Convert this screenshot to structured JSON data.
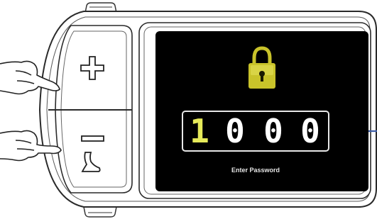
{
  "screen": {
    "password_digits": [
      "1",
      "0",
      "0",
      "0"
    ],
    "active_digit": 0,
    "prompt_label": "Enter Password",
    "active_digit_color": "#e6ea5a",
    "lock_icon_color": "#c9c32a"
  },
  "controls": {
    "plus_button_icon": "plus-icon",
    "minus_button_icon": "minus-icon",
    "walk_assist_icon": "walk-assist-icon"
  },
  "annotations": {
    "pointer_arrow_color": "#3f5fa8"
  }
}
